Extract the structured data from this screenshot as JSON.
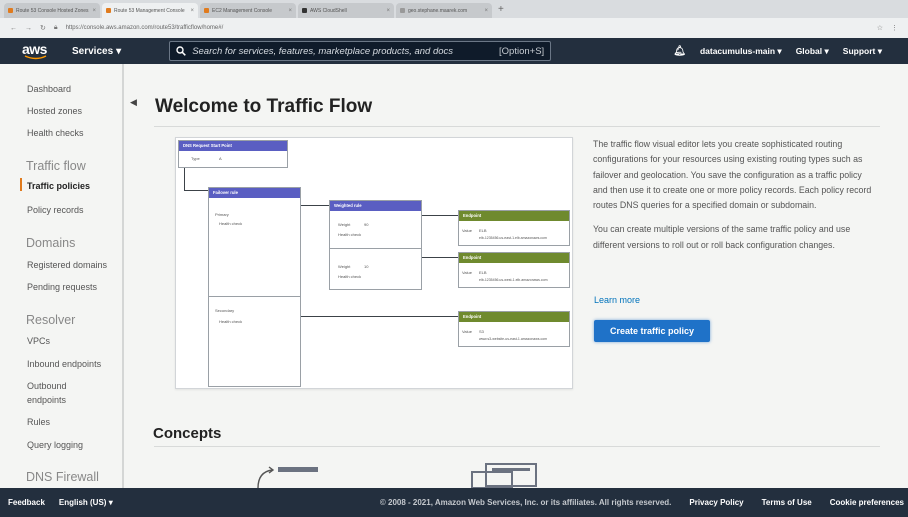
{
  "browser": {
    "tabs": [
      {
        "label": "Route 53 Console Hosted Zones"
      },
      {
        "label": "Route 53 Management Console"
      },
      {
        "label": "EC2 Management Console"
      },
      {
        "label": "AWS CloudShell"
      },
      {
        "label": "geo.stephane.maarek.com"
      }
    ],
    "url": "https://console.aws.amazon.com/route53/trafficflow/home#/"
  },
  "topnav": {
    "logo": "aws",
    "services_label": "Services",
    "search_placeholder": "Search for services, features, marketplace products, and docs",
    "search_shortcut": "[Option+S]",
    "account": "datacumulus-main",
    "region": "Global",
    "support": "Support"
  },
  "sidebar": {
    "items": [
      {
        "label": "Dashboard"
      },
      {
        "label": "Hosted zones"
      },
      {
        "label": "Health checks"
      }
    ],
    "sections": [
      {
        "title": "Traffic flow",
        "items": [
          {
            "label": "Traffic policies"
          },
          {
            "label": "Policy records"
          }
        ]
      },
      {
        "title": "Domains",
        "items": [
          {
            "label": "Registered domains"
          },
          {
            "label": "Pending requests"
          }
        ]
      },
      {
        "title": "Resolver",
        "items": [
          {
            "label": "VPCs"
          },
          {
            "label": "Inbound endpoints"
          },
          {
            "label": "Outbound"
          },
          {
            "label": "endpoints"
          },
          {
            "label": "Rules"
          },
          {
            "label": "Query logging"
          }
        ]
      },
      {
        "title": "DNS Firewall",
        "items": []
      }
    ],
    "active_item": "Traffic policies"
  },
  "main": {
    "title": "Welcome to Traffic Flow",
    "description": [
      "The traffic flow visual editor lets you create sophisticated routing configurations for your resources using existing routing types such as failover and geolocation. You save the configuration as a traffic policy and then use it to create one or more policy records. Each policy record routes DNS queries for a specified domain or subdomain.",
      "You can create multiple versions of the same traffic policy and use different versions to roll out or roll back configuration changes."
    ],
    "learn_more": "Learn more",
    "create_button": "Create traffic policy",
    "concepts_heading": "Concepts"
  },
  "diagram": {
    "start_point": {
      "title": "DNS Request Start Point",
      "type_label": "Type",
      "type_value": "A"
    },
    "failover_rule": {
      "title": "Failover rule",
      "primary": "Primary",
      "secondary": "Secondary",
      "health_check": "Health check"
    },
    "weighted_rule": {
      "title": "Weighted rule",
      "weight_label": "Weight",
      "weight_1": "90",
      "weight_2": "10",
      "health_check": "Health check"
    },
    "endpoints": [
      {
        "title": "Endpoint",
        "value_label": "Value",
        "type": "ELB",
        "address": "elb-1235456.us-east-1.elb.amazonaws.com"
      },
      {
        "title": "Endpoint",
        "value_label": "Value",
        "type": "ELB",
        "address": "elb-1235456.us-west-1.elb.amazonaws.com"
      },
      {
        "title": "Endpoint",
        "value_label": "Value",
        "type": "S3",
        "address": "www.s3-website-us-east-1.amazonaws.com"
      }
    ]
  },
  "footer": {
    "feedback": "Feedback",
    "language": "English (US)",
    "copyright": "© 2008 - 2021, Amazon Web Services, Inc. or its affiliates. All rights reserved.",
    "links": [
      {
        "label": "Privacy Policy"
      },
      {
        "label": "Terms of Use"
      },
      {
        "label": "Cookie preferences"
      }
    ]
  },
  "colors": {
    "nav_bg": "#232f3e",
    "accent": "#e07b1e",
    "primary_button": "#1f72c8",
    "link": "#0073bb",
    "rule_header": "#5a5ec2",
    "endpoint_header": "#6f8a2e"
  }
}
